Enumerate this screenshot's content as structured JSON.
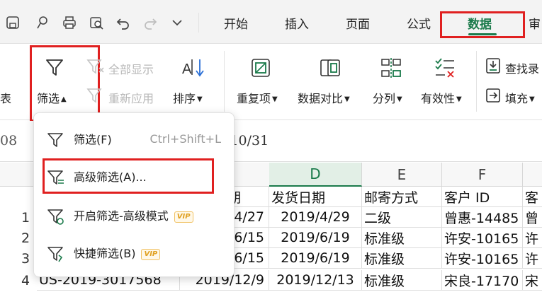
{
  "quick_access": [
    {
      "name": "save-icon"
    },
    {
      "name": "preview-icon"
    },
    {
      "name": "print-icon"
    },
    {
      "name": "print-preview-icon"
    },
    {
      "name": "undo-icon"
    },
    {
      "name": "redo-icon"
    },
    {
      "name": "more-icon"
    }
  ],
  "tabs": {
    "home": "开始",
    "insert": "插入",
    "page": "页面",
    "formula": "公式",
    "data": "数据",
    "review": "审"
  },
  "ribbon": {
    "left_cut": "表",
    "filter": "筛选",
    "show_all": "全部显示",
    "reapply": "重新应用",
    "sort": "排序",
    "duplicates": "重复项",
    "compare": "数据对比",
    "split": "分列",
    "validity": "有效性",
    "find": "查找录",
    "fill": "填充"
  },
  "formula_bar": {
    "cell_ref": "08",
    "value": "/10/31"
  },
  "columns": {
    "D": "D",
    "E": "E",
    "F": "F"
  },
  "header_row": {
    "c": "期",
    "d": "发货日期",
    "e": "邮寄方式",
    "f": "客户 ID",
    "g": "客"
  },
  "rows": [
    {
      "num": "1",
      "b": "",
      "c": "/4/27",
      "d": "2019/4/29",
      "e": "二级",
      "f": "曾惠-14485",
      "g": "曾"
    },
    {
      "num": "2",
      "b": "",
      "c": "/6/15",
      "d": "2019/6/19",
      "e": "标准级",
      "f": "许安-10165",
      "g": "许"
    },
    {
      "num": "3",
      "b": "",
      "c": "/6/15",
      "d": "2019/6/19",
      "e": "标准级",
      "f": "许安-10165",
      "g": "许"
    },
    {
      "num": "4",
      "b": "US-2019-3017568",
      "c": "2019/12/9",
      "d": "2019/12/13",
      "e": "标准级",
      "f": "宋良-17170",
      "g": "宋"
    }
  ],
  "menu": {
    "filter": "筛选(F)",
    "filter_shortcut": "Ctrl+Shift+L",
    "advanced": "高级筛选(A)...",
    "advanced_mode": "开启筛选-高级模式",
    "quick": "快捷筛选(B)",
    "vip": "VIP"
  },
  "colors": {
    "accent": "#1a7a4a",
    "annotation": "#e02020",
    "vip": "#e0a020"
  }
}
